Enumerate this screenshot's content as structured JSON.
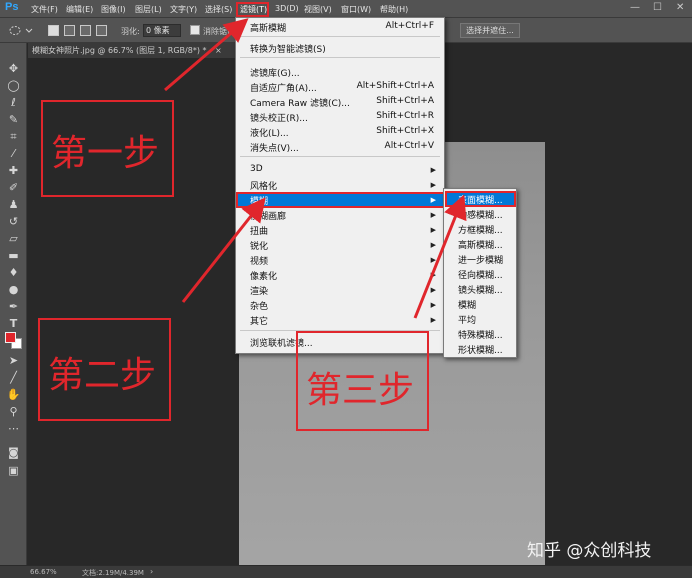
{
  "app": {
    "logo": "Ps"
  },
  "menubar": {
    "items": [
      "文件(F)",
      "编辑(E)",
      "图像(I)",
      "图层(L)",
      "文字(Y)",
      "选择(S)",
      "滤镜(T)",
      "3D(D)",
      "视图(V)",
      "窗口(W)",
      "帮助(H)"
    ],
    "window_controls": [
      "—",
      "☐",
      "✕"
    ]
  },
  "options_bar": {
    "feather_label": "羽化:",
    "feather_value": "0 像素",
    "antialias_label": "消除锯齿",
    "select_and_mask": "选择并遮住..."
  },
  "document": {
    "tab_title": "模糊女神照片.jpg @ 66.7% (图层 1, RGB/8*) *",
    "tab_close": "×"
  },
  "status_bar": {
    "zoom": "66.67%",
    "doc_size": "文档:2.19M/4.39M",
    "arrow": "›"
  },
  "filter_menu": {
    "items": [
      {
        "label": "高斯模糊",
        "shortcut": "Alt+Ctrl+F"
      },
      {
        "label": "转换为智能滤镜(S)",
        "shortcut": ""
      },
      {
        "label": "滤镜库(G)...",
        "shortcut": ""
      },
      {
        "label": "自适应广角(A)...",
        "shortcut": "Alt+Shift+Ctrl+A"
      },
      {
        "label": "Camera Raw 滤镜(C)...",
        "shortcut": "Shift+Ctrl+A"
      },
      {
        "label": "镜头校正(R)...",
        "shortcut": "Shift+Ctrl+R"
      },
      {
        "label": "液化(L)...",
        "shortcut": "Shift+Ctrl+X"
      },
      {
        "label": "消失点(V)...",
        "shortcut": "Alt+Ctrl+V"
      },
      {
        "label": "3D",
        "shortcut": ""
      },
      {
        "label": "风格化",
        "shortcut": ""
      },
      {
        "label": "模糊",
        "shortcut": ""
      },
      {
        "label": "模糊画廊",
        "shortcut": ""
      },
      {
        "label": "扭曲",
        "shortcut": ""
      },
      {
        "label": "锐化",
        "shortcut": ""
      },
      {
        "label": "视频",
        "shortcut": ""
      },
      {
        "label": "像素化",
        "shortcut": ""
      },
      {
        "label": "渲染",
        "shortcut": ""
      },
      {
        "label": "杂色",
        "shortcut": ""
      },
      {
        "label": "其它",
        "shortcut": ""
      },
      {
        "label": "浏览联机滤镜...",
        "shortcut": ""
      }
    ],
    "submenu_arrow": "▶"
  },
  "blur_submenu": {
    "items": [
      "表面模糊...",
      "动感模糊...",
      "方框模糊...",
      "高斯模糊...",
      "进一步模糊",
      "径向模糊...",
      "镜头模糊...",
      "模糊",
      "平均",
      "特殊模糊...",
      "形状模糊..."
    ]
  },
  "annotations": {
    "step1": "第一步",
    "step2": "第二步",
    "step3": "第三步",
    "watermark": "知乎 @众创科技"
  },
  "colors": {
    "accent_red": "#e0262c",
    "highlight_blue": "#0078d7",
    "foreground_swatch": "#e0262c",
    "background_swatch": "#ffffff"
  },
  "tools": [
    "move-tool",
    "marquee-tool",
    "lasso-tool",
    "quick-select-tool",
    "crop-tool",
    "eyedropper-tool",
    "healing-brush-tool",
    "brush-tool",
    "clone-stamp-tool",
    "history-brush-tool",
    "eraser-tool",
    "gradient-tool",
    "blur-tool",
    "dodge-tool",
    "pen-tool",
    "type-tool",
    "path-select-tool",
    "shape-tool",
    "hand-tool",
    "zoom-tool",
    "more-tools"
  ]
}
